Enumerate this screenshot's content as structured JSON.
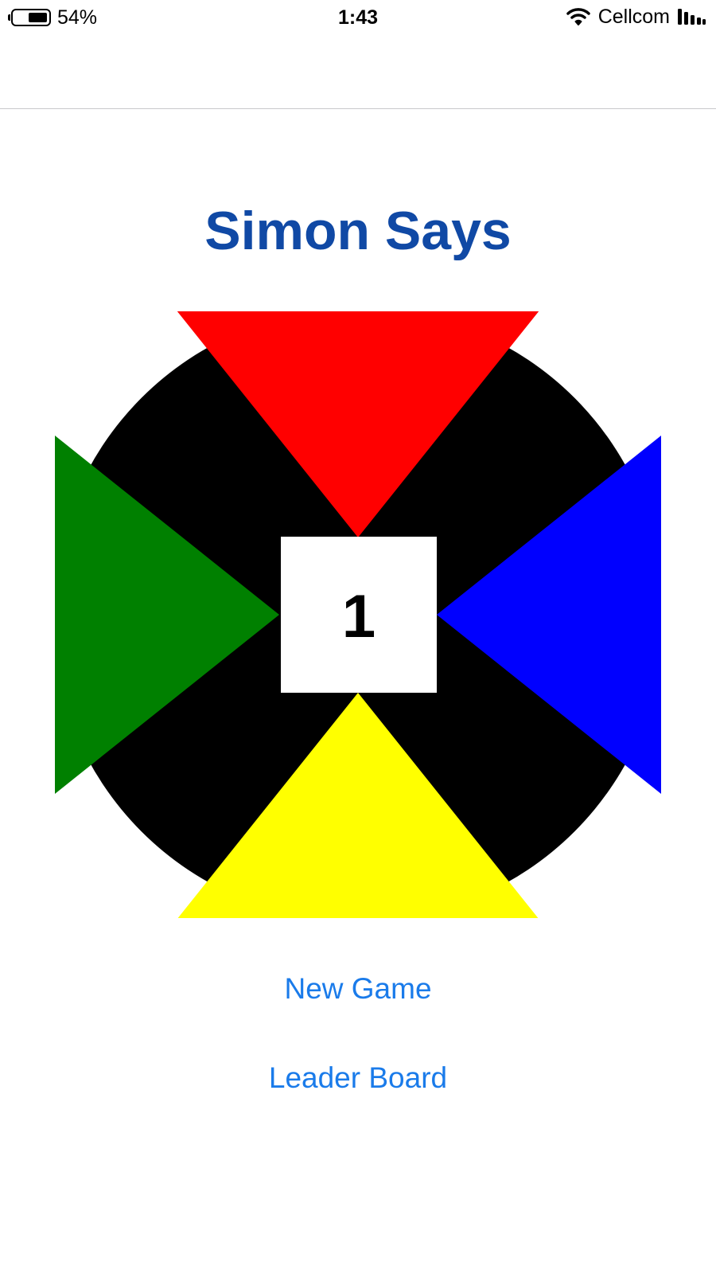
{
  "status_bar": {
    "battery_level": "54%",
    "time": "1:43",
    "carrier": "Cellcom",
    "icons": [
      "battery-icon",
      "wifi-icon",
      "signal-icon"
    ]
  },
  "game": {
    "title": "Simon Says",
    "counter": "1",
    "buttons": [
      {
        "name": "red",
        "color": "#ff0000"
      },
      {
        "name": "blue",
        "color": "#0000ff"
      },
      {
        "name": "yellow",
        "color": "#ffff00"
      },
      {
        "name": "green",
        "color": "#008000"
      }
    ],
    "board_color": "#000000",
    "center_color": "#ffffff"
  },
  "menu": {
    "new_game": "New Game",
    "leader_board": "Leader Board"
  },
  "colors": {
    "title": "#1049a5",
    "link": "#1a7bea"
  }
}
